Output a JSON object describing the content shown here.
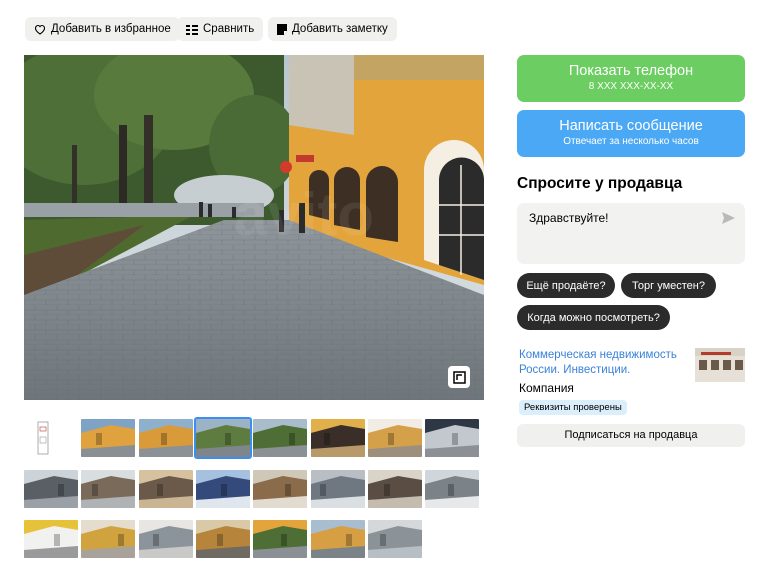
{
  "toolbar": {
    "favorite_label": "Добавить в избранное",
    "compare_label": "Сравнить",
    "note_label": "Добавить заметку"
  },
  "gallery": {
    "selected_index": 3,
    "thumbnail_count": 23
  },
  "contact": {
    "show_phone_label": "Показать телефон",
    "phone_masked": "8 XXX XXX-XX-XX",
    "write_message_label": "Написать сообщение",
    "reply_time": "Отвечает за несколько часов",
    "phone_color": "#6ccd62",
    "message_color": "#4aa8f5"
  },
  "ask": {
    "title": "Спросите у продавца",
    "message_value": "Здравствуйте!",
    "chips": [
      "Ещё продаёте?",
      "Торг уместен?",
      "Когда можно посмотреть?"
    ]
  },
  "seller": {
    "name": "Коммерческая недвижимость России. Инвестиции.",
    "type": "Компания",
    "badge": "Реквизиты проверены",
    "subscribe_label": "Подписаться на продавца"
  }
}
